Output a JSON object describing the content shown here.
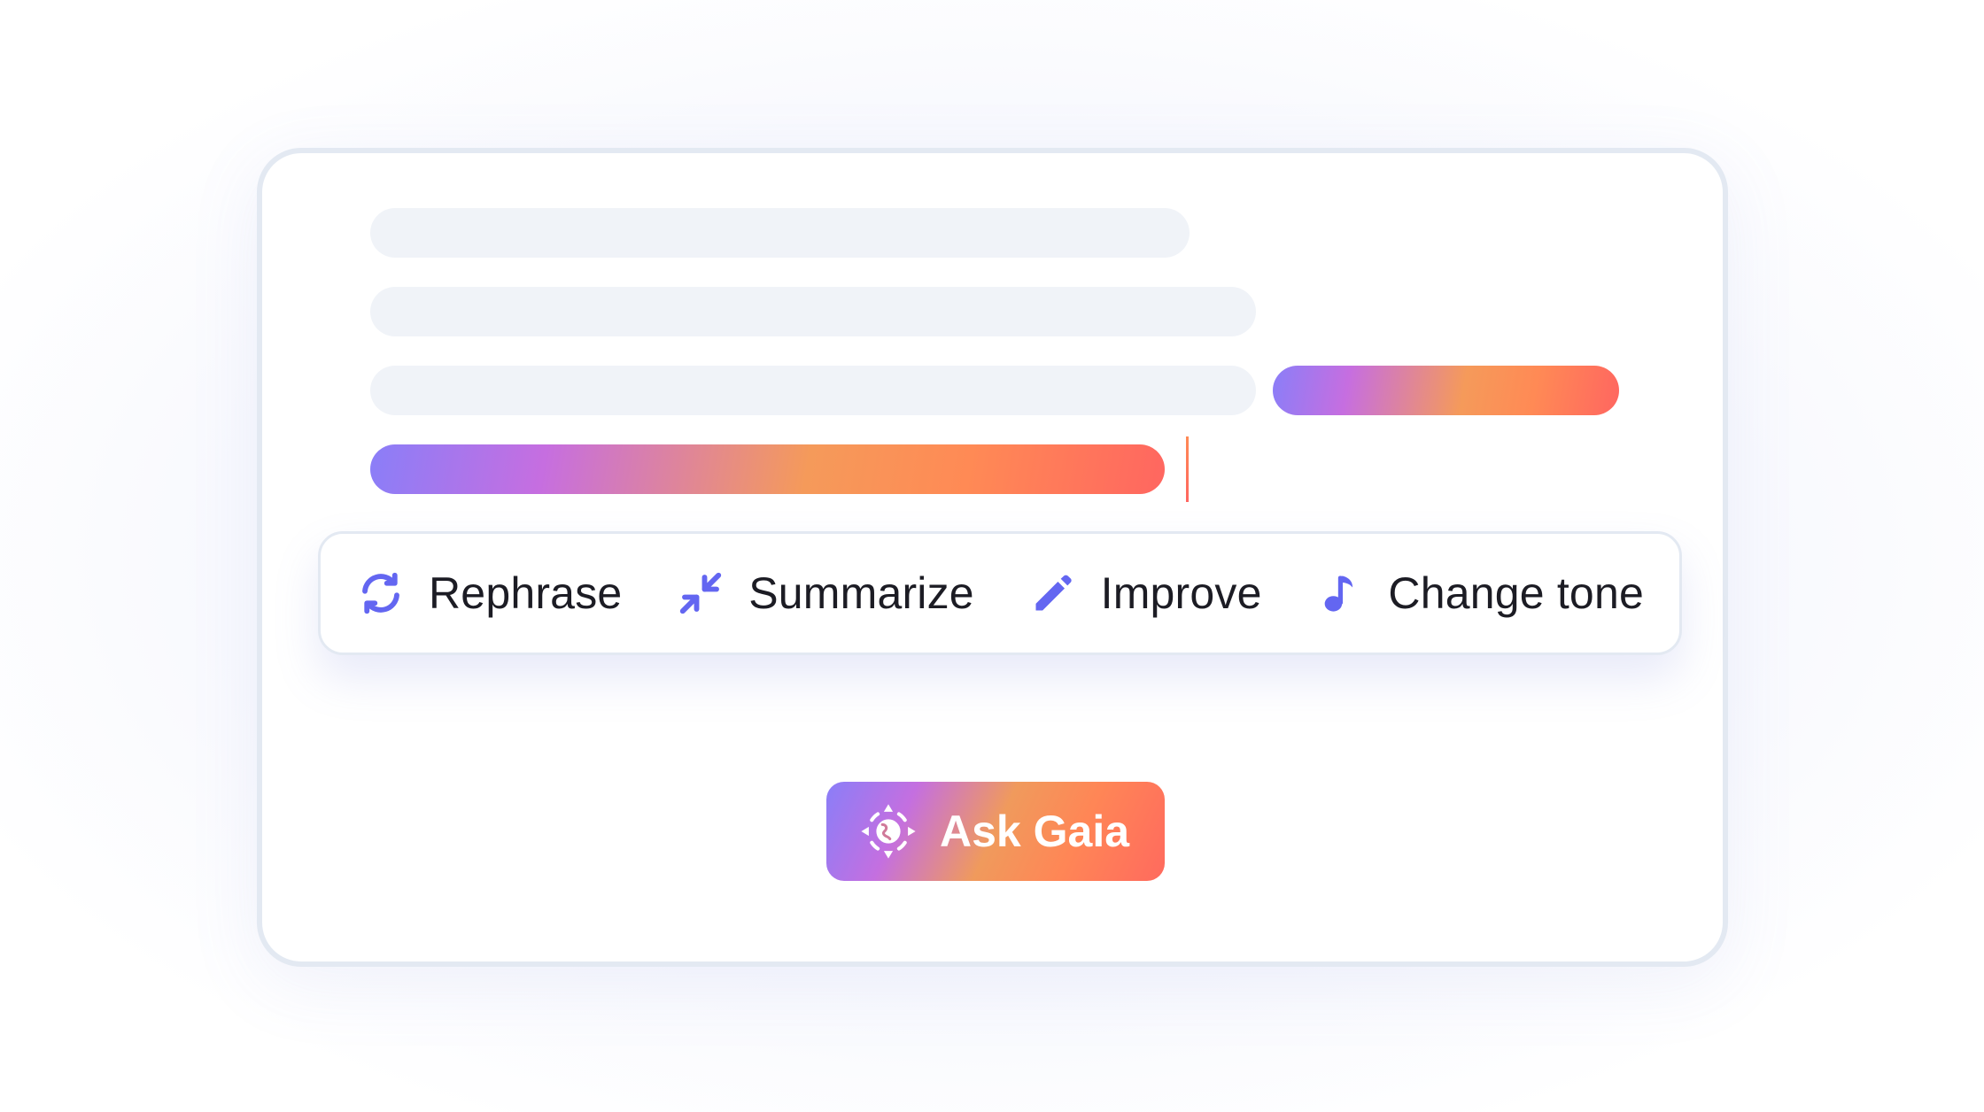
{
  "editor": {
    "selection_gradient": [
      "#8a7ef8",
      "#c66ee0",
      "#f59a5a",
      "#ff6660"
    ],
    "placeholder_color": "#f0f3f8"
  },
  "toolbar": {
    "accent_color": "#6366f1",
    "items": [
      {
        "label": "Rephrase",
        "icon": "refresh-icon"
      },
      {
        "label": "Summarize",
        "icon": "collapse-arrows-icon"
      },
      {
        "label": "Improve",
        "icon": "pencil-icon"
      },
      {
        "label": "Change tone",
        "icon": "music-note-icon"
      }
    ]
  },
  "ask_button": {
    "label": "Ask Gaia",
    "icon": "gaia-logo-icon"
  }
}
